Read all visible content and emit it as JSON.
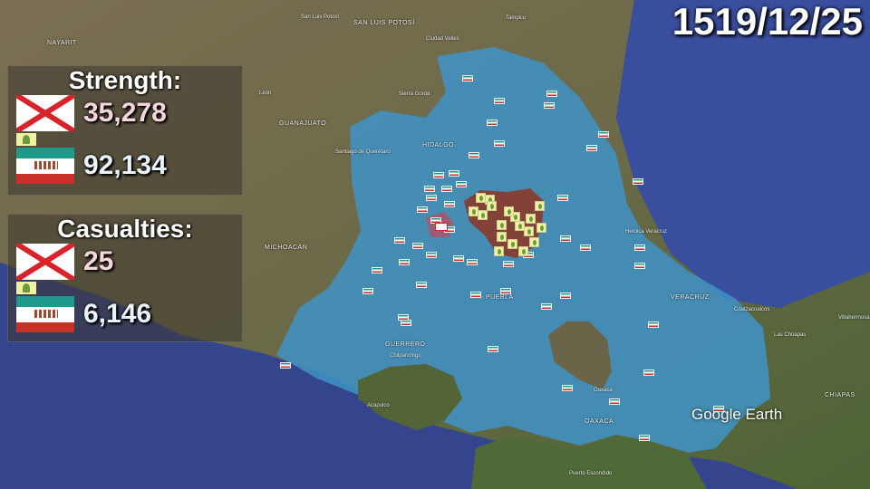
{
  "date": "1519/12/25",
  "watermark": "Google Earth",
  "strength": {
    "title": "Strength:",
    "spanish": "35,278",
    "aztec": "92,134"
  },
  "casualties": {
    "title": "Casualties:",
    "spanish": "25",
    "aztec": "6,146"
  },
  "colors": {
    "aztec_territory": "#3a8cc4",
    "tlaxcala_territory": "#8a3a2a",
    "ocean": "#2f3f8a",
    "land": "#6e6a4a"
  },
  "map_labels": [
    "NAYARIT",
    "GUANAJUATO",
    "León",
    "MICHOACÁN",
    "San Luis Potosí",
    "SAN LUIS POTOSÍ",
    "Ciudad Valles",
    "Tampico",
    "Sierra Gorda",
    "HIDALGO",
    "Santiago de Querétaro",
    "PUEBLA",
    "GUERRERO",
    "Chilpancingo",
    "Acapulco",
    "Oaxaca",
    "OAXACA",
    "VERACRUZ",
    "Heroica Veracruz",
    "Coatzacoalcos",
    "Las Choapas",
    "Villahermosa",
    "CHIAPAS",
    "Puerto Escondido"
  ]
}
